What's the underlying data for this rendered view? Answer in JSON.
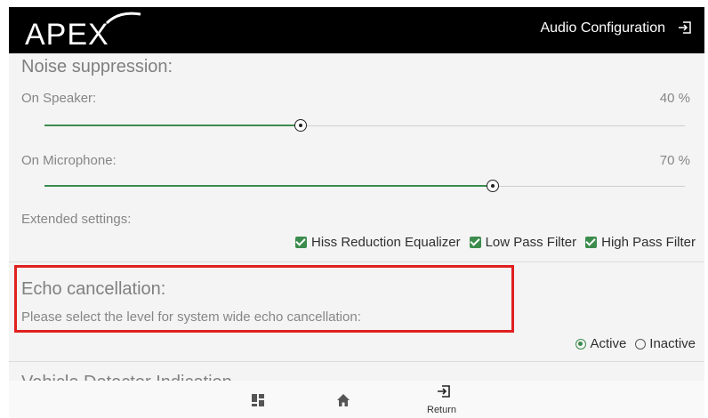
{
  "header": {
    "logo_text": "APEX",
    "title": "Audio Configuration",
    "exit_icon": "exit-icon"
  },
  "noise_suppression": {
    "title": "Noise suppression:",
    "speaker": {
      "label": "On Speaker:",
      "value_text": "40 %",
      "level": 0.4
    },
    "microphone": {
      "label": "On Microphone:",
      "value_text": "70 %",
      "level": 0.7
    },
    "extended_label": "Extended settings:",
    "checkboxes": [
      {
        "label": "Hiss Reduction Equalizer",
        "checked": true
      },
      {
        "label": "Low Pass Filter",
        "checked": true
      },
      {
        "label": "High Pass Filter",
        "checked": true
      }
    ]
  },
  "echo_cancellation": {
    "title": "Echo cancellation:",
    "description": "Please select the level for system wide echo cancellation:",
    "options": [
      {
        "label": "Active",
        "selected": true
      },
      {
        "label": "Inactive",
        "selected": false
      }
    ]
  },
  "next_section_partial": "Vehicle Detector Indication",
  "bottom_nav": {
    "items": [
      {
        "icon": "dashboard-icon",
        "label": ""
      },
      {
        "icon": "home-icon",
        "label": ""
      },
      {
        "icon": "return-icon",
        "label": "Return"
      }
    ]
  },
  "colors": {
    "accent": "#3c8c4d",
    "header_bg": "#000000",
    "highlight": "#e02020"
  }
}
